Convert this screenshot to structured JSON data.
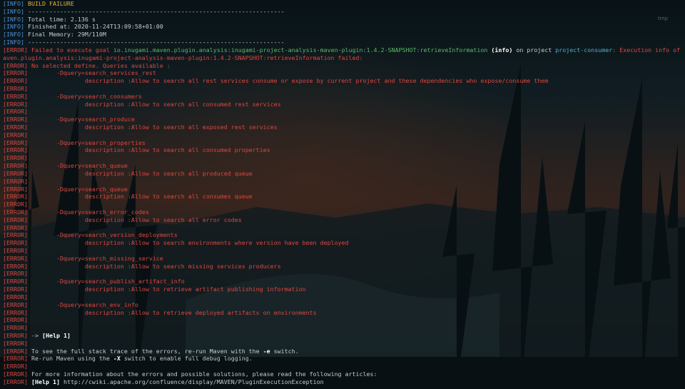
{
  "window": {
    "corner_tag": "tmp"
  },
  "colors": {
    "info": "#4d8fd6",
    "error": "#e0463f",
    "yellow": "#e3b341",
    "green": "#5cb86a",
    "cyan": "#4fb3c4",
    "bold": "#ffffff",
    "plain": "#c6ccd0"
  },
  "lines": [
    {
      "level": "INFO",
      "segments": [
        {
          "style": "yellow",
          "text": " BUILD FAILURE"
        }
      ]
    },
    {
      "level": "INFO",
      "segments": [
        {
          "style": "plain",
          "text": " ------------------------------------------------------------------------"
        }
      ]
    },
    {
      "level": "INFO",
      "segments": [
        {
          "style": "plain",
          "text": " Total time: 2.136 s"
        }
      ]
    },
    {
      "level": "INFO",
      "segments": [
        {
          "style": "plain",
          "text": " Finished at: 2020-11-24T13:09:58+01:00"
        }
      ]
    },
    {
      "level": "INFO",
      "segments": [
        {
          "style": "plain",
          "text": " Final Memory: 29M/110M"
        }
      ]
    },
    {
      "level": "INFO",
      "segments": [
        {
          "style": "plain",
          "text": " ------------------------------------------------------------------------"
        }
      ]
    },
    {
      "level": "ERROR",
      "segments": [
        {
          "style": "red",
          "text": " Failed to execute goal "
        },
        {
          "style": "green",
          "text": "io.inugami.maven.plugin.analysis:inugami-project-analysis-maven-plugin:1.4.2-SNAPSHOT:retrieveInformation"
        },
        {
          "style": "bold",
          "text": " (info)"
        },
        {
          "style": "plain",
          "text": " on project "
        },
        {
          "style": "cyan",
          "text": "project-consumer"
        },
        {
          "style": "red",
          "text": ": Execution info of goal io.inugami.m"
        }
      ]
    },
    {
      "level": "",
      "segments": [
        {
          "style": "red",
          "text": "aven.plugin.analysis:inugami-project-analysis-maven-plugin:1.4.2-SNAPSHOT:retrieveInformation failed:"
        }
      ]
    },
    {
      "level": "ERROR",
      "segments": [
        {
          "style": "red",
          "text": " No selected define. Queries available :"
        }
      ]
    },
    {
      "level": "ERROR",
      "segments": [
        {
          "style": "red",
          "text": "        -Dquery=search_services_rest"
        }
      ]
    },
    {
      "level": "ERROR",
      "segments": [
        {
          "style": "red",
          "text": "                description :Allow to search all rest services consume or expose by current project and these dependencies who expose/consume them"
        }
      ]
    },
    {
      "level": "ERROR",
      "segments": []
    },
    {
      "level": "ERROR",
      "segments": [
        {
          "style": "red",
          "text": "        -Dquery=search_consumers"
        }
      ]
    },
    {
      "level": "ERROR",
      "segments": [
        {
          "style": "red",
          "text": "                description :Allow to search all consumed rest services"
        }
      ]
    },
    {
      "level": "ERROR",
      "segments": []
    },
    {
      "level": "ERROR",
      "segments": [
        {
          "style": "red",
          "text": "        -Dquery=search_produce"
        }
      ]
    },
    {
      "level": "ERROR",
      "segments": [
        {
          "style": "red",
          "text": "                description :Allow to search all exposed rest services"
        }
      ]
    },
    {
      "level": "ERROR",
      "segments": []
    },
    {
      "level": "ERROR",
      "segments": [
        {
          "style": "red",
          "text": "        -Dquery=search_properties"
        }
      ]
    },
    {
      "level": "ERROR",
      "segments": [
        {
          "style": "red",
          "text": "                description :Allow to search all consumed properties"
        }
      ]
    },
    {
      "level": "ERROR",
      "segments": []
    },
    {
      "level": "ERROR",
      "segments": [
        {
          "style": "red",
          "text": "        -Dquery=search_queue"
        }
      ]
    },
    {
      "level": "ERROR",
      "segments": [
        {
          "style": "red",
          "text": "                description :Allow to search all produced queue"
        }
      ]
    },
    {
      "level": "ERROR",
      "segments": []
    },
    {
      "level": "ERROR",
      "segments": [
        {
          "style": "red",
          "text": "        -Dquery=search_queue"
        }
      ]
    },
    {
      "level": "ERROR",
      "segments": [
        {
          "style": "red",
          "text": "                description :Allow to search all consumes queue"
        }
      ]
    },
    {
      "level": "ERROR",
      "segments": []
    },
    {
      "level": "ERROR",
      "segments": [
        {
          "style": "red",
          "text": "        -Dquery=search_error_codes"
        }
      ]
    },
    {
      "level": "ERROR",
      "segments": [
        {
          "style": "red",
          "text": "                description :Allow to search all error codes"
        }
      ]
    },
    {
      "level": "ERROR",
      "segments": []
    },
    {
      "level": "ERROR",
      "segments": [
        {
          "style": "red",
          "text": "        -Dquery=search_version_deployments"
        }
      ]
    },
    {
      "level": "ERROR",
      "segments": [
        {
          "style": "red",
          "text": "                description :Allow to search environments where version have been deployed"
        }
      ]
    },
    {
      "level": "ERROR",
      "segments": []
    },
    {
      "level": "ERROR",
      "segments": [
        {
          "style": "red",
          "text": "        -Dquery=search_missing_service"
        }
      ]
    },
    {
      "level": "ERROR",
      "segments": [
        {
          "style": "red",
          "text": "                description :Allow to search missing services producers"
        }
      ]
    },
    {
      "level": "ERROR",
      "segments": []
    },
    {
      "level": "ERROR",
      "segments": [
        {
          "style": "red",
          "text": "        -Dquery=search_publish_artifact_info"
        }
      ]
    },
    {
      "level": "ERROR",
      "segments": [
        {
          "style": "red",
          "text": "                description :Allow to retrieve artifact publishing information"
        }
      ]
    },
    {
      "level": "ERROR",
      "segments": []
    },
    {
      "level": "ERROR",
      "segments": [
        {
          "style": "red",
          "text": "        -Dquery=search_env_info"
        }
      ]
    },
    {
      "level": "ERROR",
      "segments": [
        {
          "style": "red",
          "text": "                description :Allow to retrieve deployed artifacts on environments"
        }
      ]
    },
    {
      "level": "ERROR",
      "segments": []
    },
    {
      "level": "ERROR",
      "segments": []
    },
    {
      "level": "ERROR",
      "segments": [
        {
          "style": "plain",
          "text": " -> "
        },
        {
          "style": "bold",
          "text": "[Help 1]"
        }
      ]
    },
    {
      "level": "ERROR",
      "segments": []
    },
    {
      "level": "ERROR",
      "segments": [
        {
          "style": "plain",
          "text": " To see the full stack trace of the errors, re-run Maven with the "
        },
        {
          "style": "bold",
          "text": "-e"
        },
        {
          "style": "plain",
          "text": " switch."
        }
      ]
    },
    {
      "level": "ERROR",
      "segments": [
        {
          "style": "plain",
          "text": " Re-run Maven using the "
        },
        {
          "style": "bold",
          "text": "-X"
        },
        {
          "style": "plain",
          "text": " switch to enable full debug logging."
        }
      ]
    },
    {
      "level": "ERROR",
      "segments": []
    },
    {
      "level": "ERROR",
      "segments": [
        {
          "style": "plain",
          "text": " For more information about the errors and possible solutions, please read the following articles:"
        }
      ]
    },
    {
      "level": "ERROR",
      "segments": [
        {
          "style": "bold",
          "text": " [Help 1]"
        },
        {
          "style": "plain",
          "text": " http://cwiki.apache.org/confluence/display/MAVEN/PluginExecutionException"
        }
      ]
    }
  ]
}
